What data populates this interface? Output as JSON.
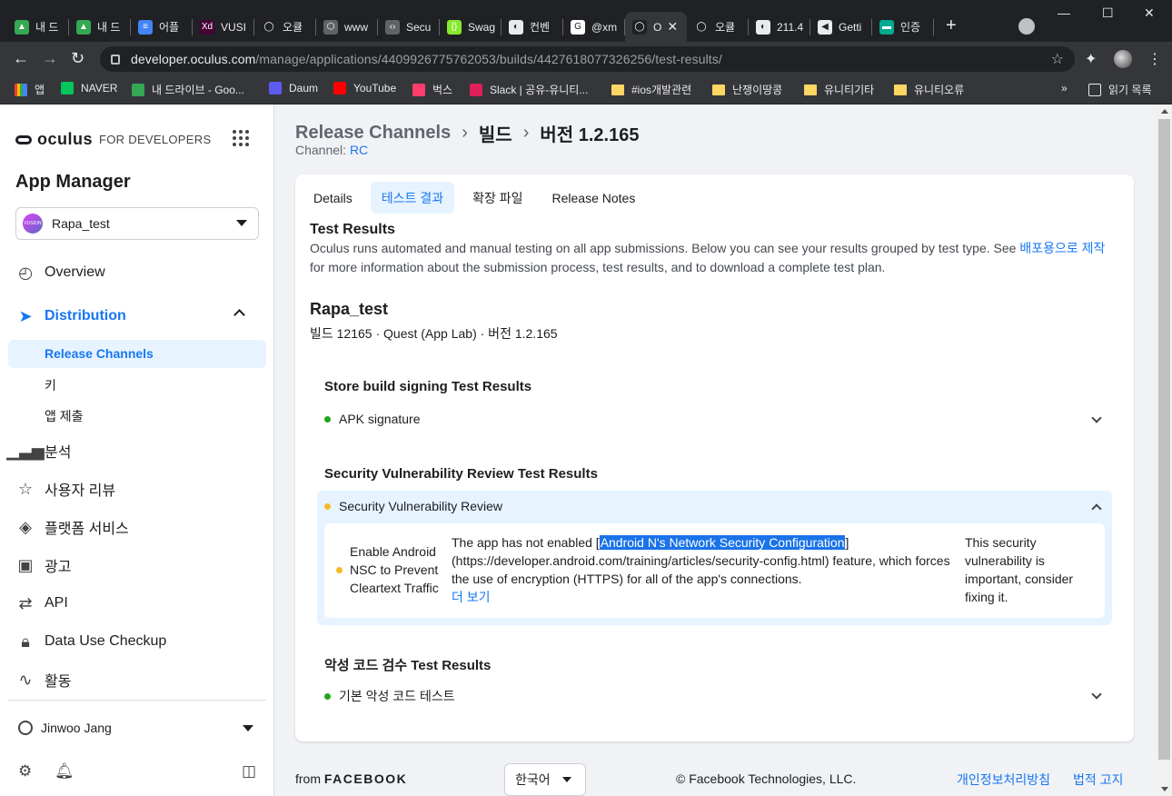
{
  "browser": {
    "tabs": [
      {
        "label": "내 드",
        "color": "#34a853",
        "glyph": "▲"
      },
      {
        "label": "내 드",
        "color": "#34a853",
        "glyph": "▲"
      },
      {
        "label": "어플",
        "color": "#4285f4",
        "glyph": "≡"
      },
      {
        "label": "VUSI",
        "color": "#470137",
        "glyph": "Xd"
      },
      {
        "label": "오큘",
        "color": "#202124",
        "glyph": "◯"
      },
      {
        "label": "www",
        "color": "#5f6368",
        "glyph": "⬡"
      },
      {
        "label": "Secu",
        "color": "#5f6368",
        "glyph": "‹›"
      },
      {
        "label": "Swag",
        "color": "#85ea2d",
        "glyph": "{}"
      },
      {
        "label": "컨벤",
        "color": "#e8eaed",
        "glyph": "◐"
      },
      {
        "label": "@xm",
        "color": "#ffffff",
        "glyph": "G"
      },
      {
        "label": "O",
        "color": "#202124",
        "glyph": "◯",
        "active": true
      },
      {
        "label": "오큘",
        "color": "#202124",
        "glyph": "◯"
      },
      {
        "label": "211.4",
        "color": "#e8eaed",
        "glyph": "◐"
      },
      {
        "label": "Getti",
        "color": "#e8eaed",
        "glyph": "◀"
      },
      {
        "label": "인증",
        "color": "#00a98f",
        "glyph": "▬"
      }
    ],
    "new_tab": "+",
    "url_host": "developer.oculus.com",
    "url_path": "/manage/applications/4409926775762053/builds/4427618077326256/test-results/",
    "bookmarks": [
      {
        "label": "앱",
        "type": "apps"
      },
      {
        "label": "NAVER",
        "type": "icon",
        "color": "#03c75a"
      },
      {
        "label": "내 드라이브 - Goo...",
        "type": "icon",
        "color": "#34a853"
      },
      {
        "label": "Daum",
        "type": "icon",
        "color": "#5b5bf0"
      },
      {
        "label": "YouTube",
        "type": "icon",
        "color": "#ff0000"
      },
      {
        "label": "벅스",
        "type": "icon",
        "color": "#ff3d6c"
      },
      {
        "label": "Slack | 공유-유니티...",
        "type": "icon",
        "color": "#e01e5a"
      },
      {
        "label": "#ios개발관련",
        "type": "folder"
      },
      {
        "label": "난쟁이땅콩",
        "type": "folder"
      },
      {
        "label": "유니티기타",
        "type": "folder"
      },
      {
        "label": "유니티오류",
        "type": "folder"
      }
    ],
    "bookmarks_more": "»",
    "reading_list": "읽기 목록"
  },
  "sidebar": {
    "brand_word": "oculus",
    "brand_sub": "FOR DEVELOPERS",
    "app_manager": "App Manager",
    "app_selector": {
      "name": "Rapa_test",
      "icon_text": "VUSION"
    },
    "nav": {
      "overview": "Overview",
      "distribution": "Distribution",
      "release_channels": "Release Channels",
      "keys": "키",
      "submit": "앱 제출",
      "analytics": "분석",
      "reviews": "사용자 리뷰",
      "platform": "플랫폼 서비스",
      "ads": "광고",
      "api": "API",
      "data_use": "Data Use Checkup",
      "activity": "활동"
    },
    "user": "Jinwoo Jang"
  },
  "main": {
    "breadcrumb": [
      "Release Channels",
      "빌드",
      "버전 1.2.165"
    ],
    "channel_label": "Channel: ",
    "channel_value": "RC",
    "tabs": [
      "Details",
      "테스트 결과",
      "확장 파일",
      "Release Notes"
    ],
    "test_results_title": "Test Results",
    "test_results_desc": "Oculus runs automated and manual testing on all app submissions. Below you can see your results grouped by test type. See ",
    "test_results_link": "배포용으로 제작",
    "test_results_desc2": " for more information about the submission process, test results, and to download a complete test plan.",
    "app_title": "Rapa_test",
    "app_meta": "빌드 12165 · Quest (App Lab) · 버전 1.2.165",
    "sections": [
      {
        "title": "Store build signing Test Results",
        "item": "APK signature",
        "status_color": "#20a520"
      },
      {
        "title": "Security Vulnerability Review Test Results",
        "item": "Security Vulnerability Review",
        "status_color": "#f7b928"
      },
      {
        "title": "악성 코드 검수 Test Results",
        "item": "기본 악성 코드 테스트",
        "status_color": "#20a520"
      }
    ],
    "vulnerability": {
      "name": "Enable Android NSC to Prevent Cleartext Traffic",
      "desc_pre": "The app has not enabled [",
      "desc_highlight": "Android N's Network Security Configuration",
      "desc_post": "](https://developer.android.com/training/articles/security-config.html) feature, which forces the use of encryption (HTTPS) for all of the app's connections.",
      "more": "더 보기",
      "note": "This security vulnerability is important, consider fixing it."
    }
  },
  "footer": {
    "from": "from",
    "facebook": "FACEBOOK",
    "language": "한국어",
    "copyright": "© Facebook Technologies, LLC.",
    "privacy": "개인정보처리방침",
    "legal": "법적 고지"
  }
}
